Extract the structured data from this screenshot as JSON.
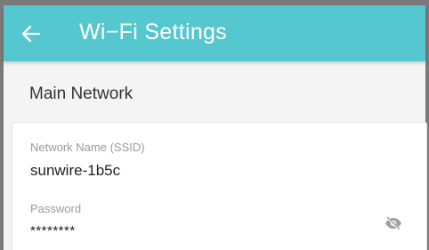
{
  "appbar": {
    "title": "Wi−Fi Settings",
    "back_icon": "arrow-left-icon",
    "color": "#55c7cf"
  },
  "section": {
    "title": "Main Network"
  },
  "fields": {
    "ssid": {
      "label": "Network Name (SSID)",
      "value": "sunwire-1b5c"
    },
    "password": {
      "label": "Password",
      "value": "********",
      "toggle_icon": "eye-off-icon"
    }
  }
}
